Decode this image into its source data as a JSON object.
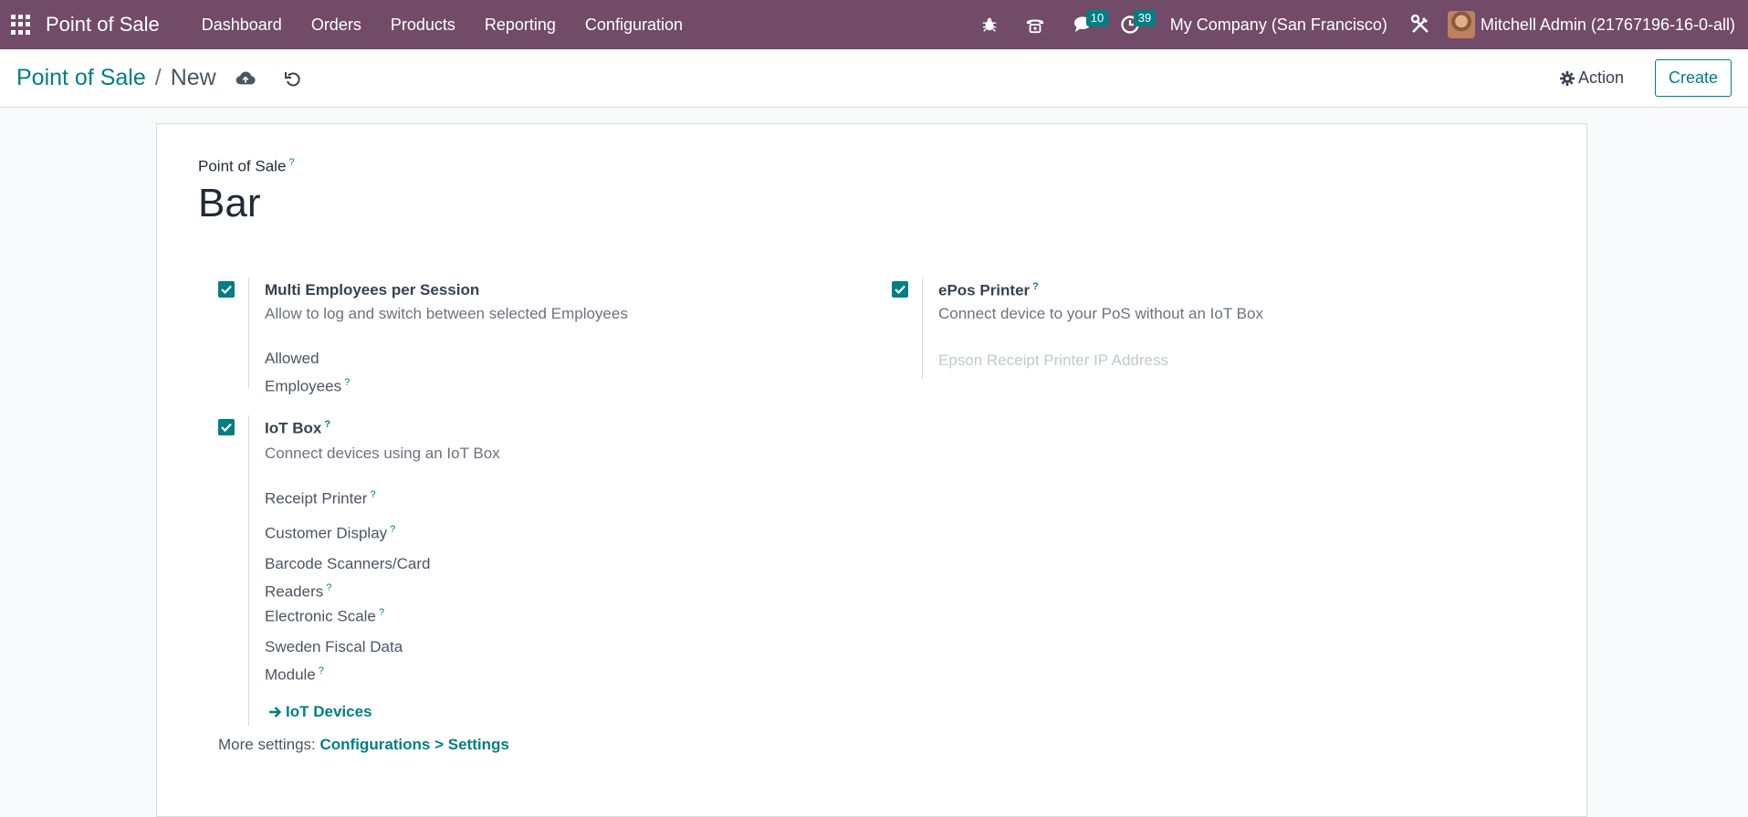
{
  "navbar": {
    "app_name": "Point of Sale",
    "menu": [
      "Dashboard",
      "Orders",
      "Products",
      "Reporting",
      "Configuration"
    ],
    "messages_count": "10",
    "activities_count": "39",
    "company": "My Company (San Francisco)",
    "user": "Mitchell Admin (21767196-16-0-all)"
  },
  "breadcrumb": {
    "parent": "Point of Sale",
    "separator": "/",
    "current": "New"
  },
  "actions": {
    "action_label": "Action",
    "create_label": "Create"
  },
  "form": {
    "name_label": "Point of Sale",
    "tooltip_marker": "?",
    "name_value": "Bar",
    "settings": {
      "multi_employees": {
        "title": "Multi Employees per Session",
        "description": "Allow to log and switch between selected Employees",
        "sub_label_line1": "Allowed",
        "sub_label_line2": "Employees",
        "checked": true
      },
      "epos_printer": {
        "title": "ePos Printer",
        "description": "Connect device to your PoS without an IoT Box",
        "ip_placeholder": "Epson Receipt Printer IP Address",
        "checked": true
      },
      "iot_box": {
        "title": "IoT Box",
        "description": "Connect devices using an IoT Box",
        "receipt_printer": "Receipt Printer",
        "customer_display": "Customer Display",
        "barcode_line1": "Barcode Scanners/Card",
        "barcode_line2": "Readers",
        "electronic_scale": "Electronic Scale",
        "sweden_line1": "Sweden Fiscal Data",
        "sweden_line2": "Module",
        "iot_devices_link": "IoT Devices",
        "checked": true
      }
    },
    "more_settings_prefix": "More settings:",
    "more_settings_link": "Configurations > Settings"
  },
  "colors": {
    "navbar": "#714b67",
    "accent": "#017e84"
  }
}
